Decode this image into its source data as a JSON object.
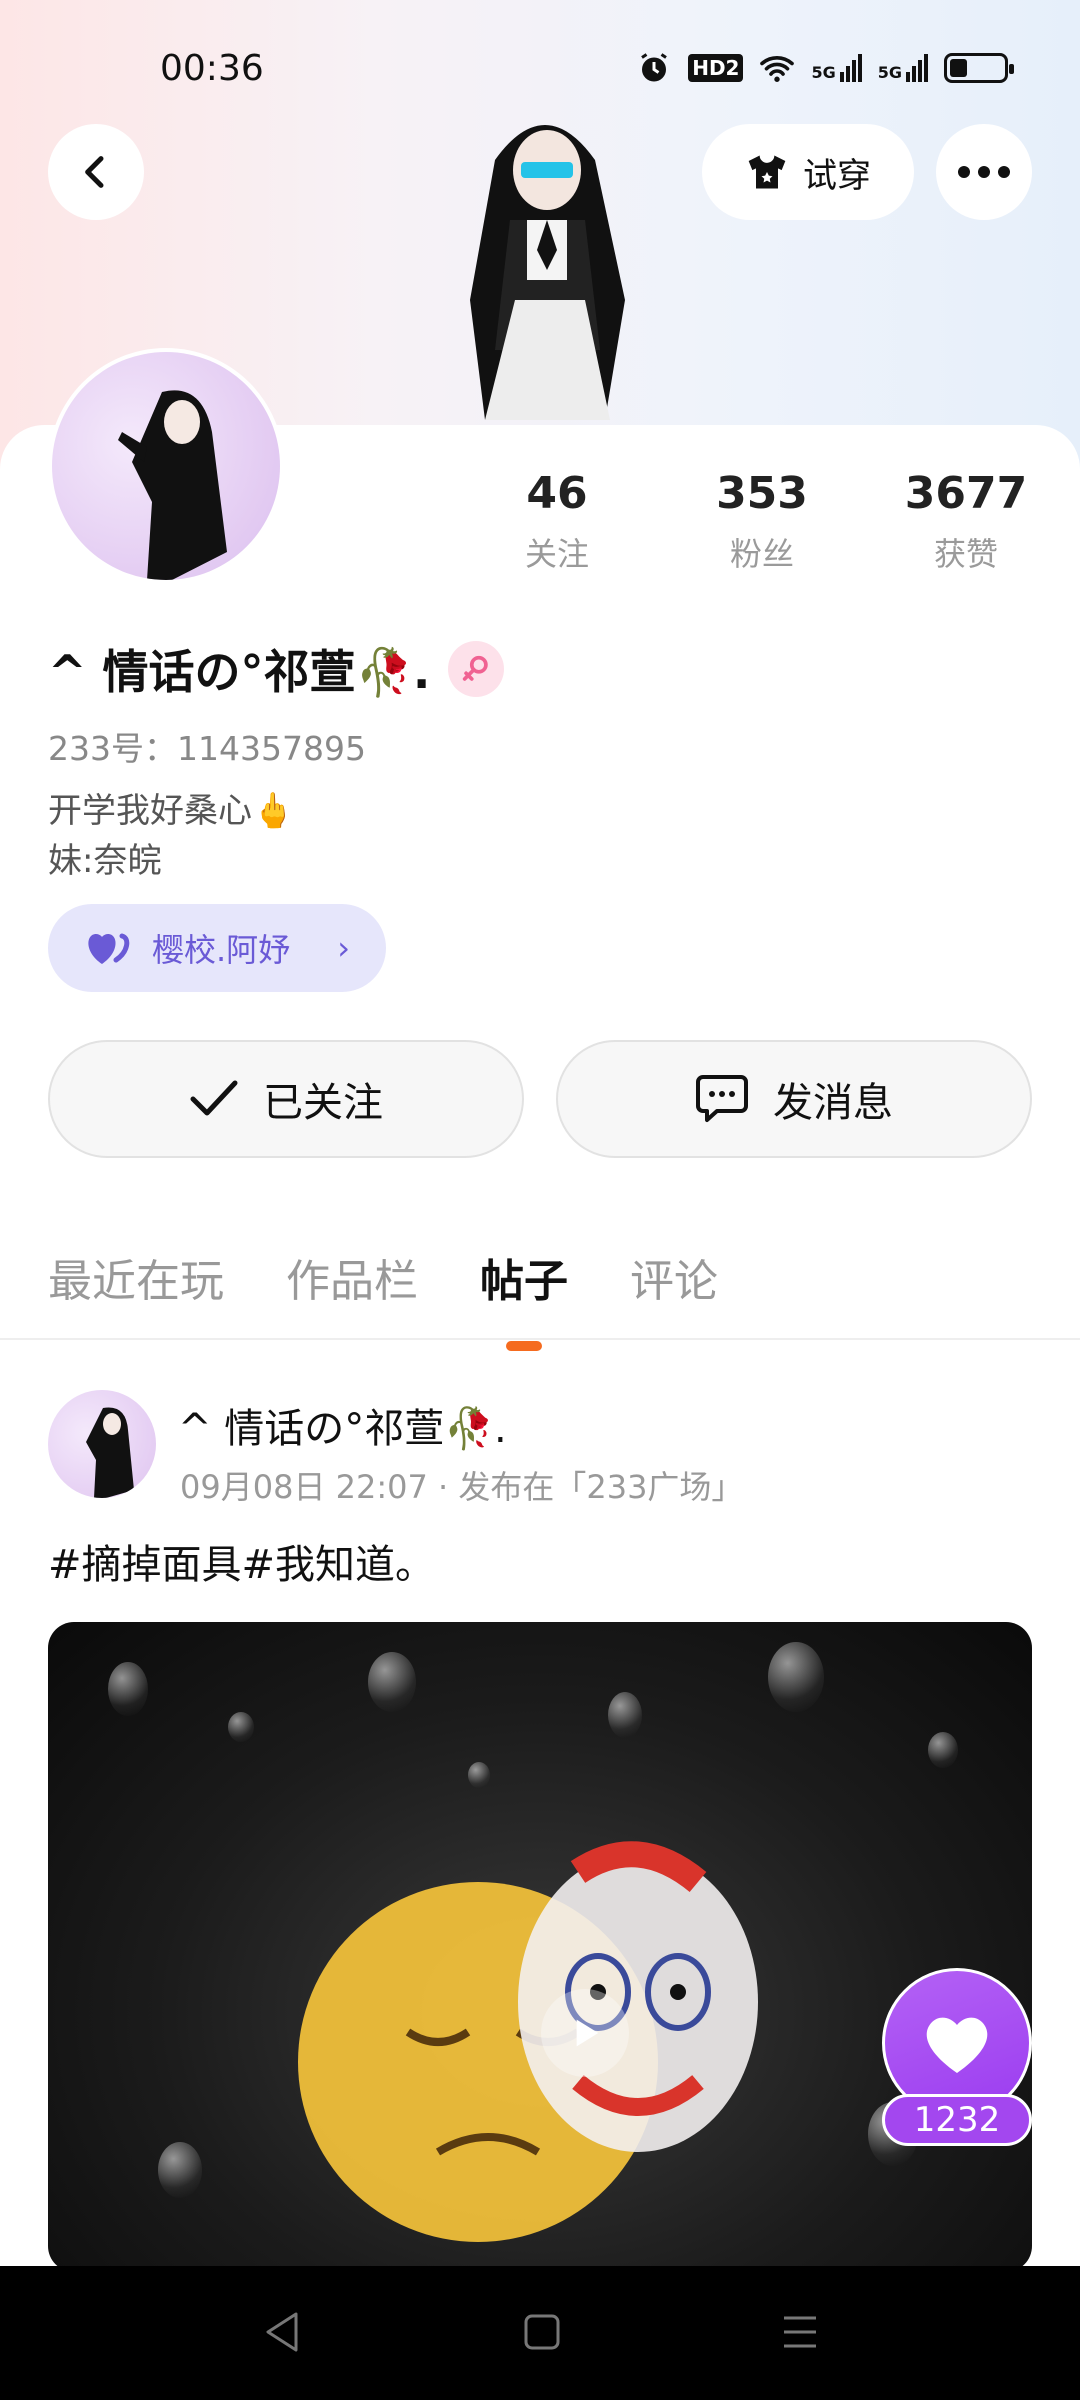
{
  "status_bar": {
    "time": "00:36",
    "network_1": "5G",
    "network_2": "5G",
    "hd_badge": "HD2"
  },
  "header": {
    "try_on_label": "试穿"
  },
  "stats": [
    {
      "value": "46",
      "label": "关注"
    },
    {
      "value": "353",
      "label": "粉丝"
    },
    {
      "value": "3677",
      "label": "获赞"
    }
  ],
  "profile": {
    "name": "^ 情话の°祁萱🥀.",
    "uid": "233号：114357895",
    "bio_line1": "开学我好桑心🖕",
    "bio_line2": "妹:奈皖",
    "group": "樱校.阿妤"
  },
  "actions": {
    "follow_label": "已关注",
    "message_label": "发消息"
  },
  "tabs": [
    {
      "label": "最近在玩",
      "active": false
    },
    {
      "label": "作品栏",
      "active": false
    },
    {
      "label": "帖子",
      "active": true
    },
    {
      "label": "评论",
      "active": false
    }
  ],
  "post": {
    "author": "^ 情话の°祁萱🥀.",
    "meta": "09月08日 22:07 · 发布在「233广场」",
    "text": "#摘掉面具#我知道。",
    "likes": "1232"
  },
  "colors": {
    "accent_orange": "#f56b1f",
    "like_purple": "#a347ef",
    "chip_purple": "#6a5ad6"
  }
}
